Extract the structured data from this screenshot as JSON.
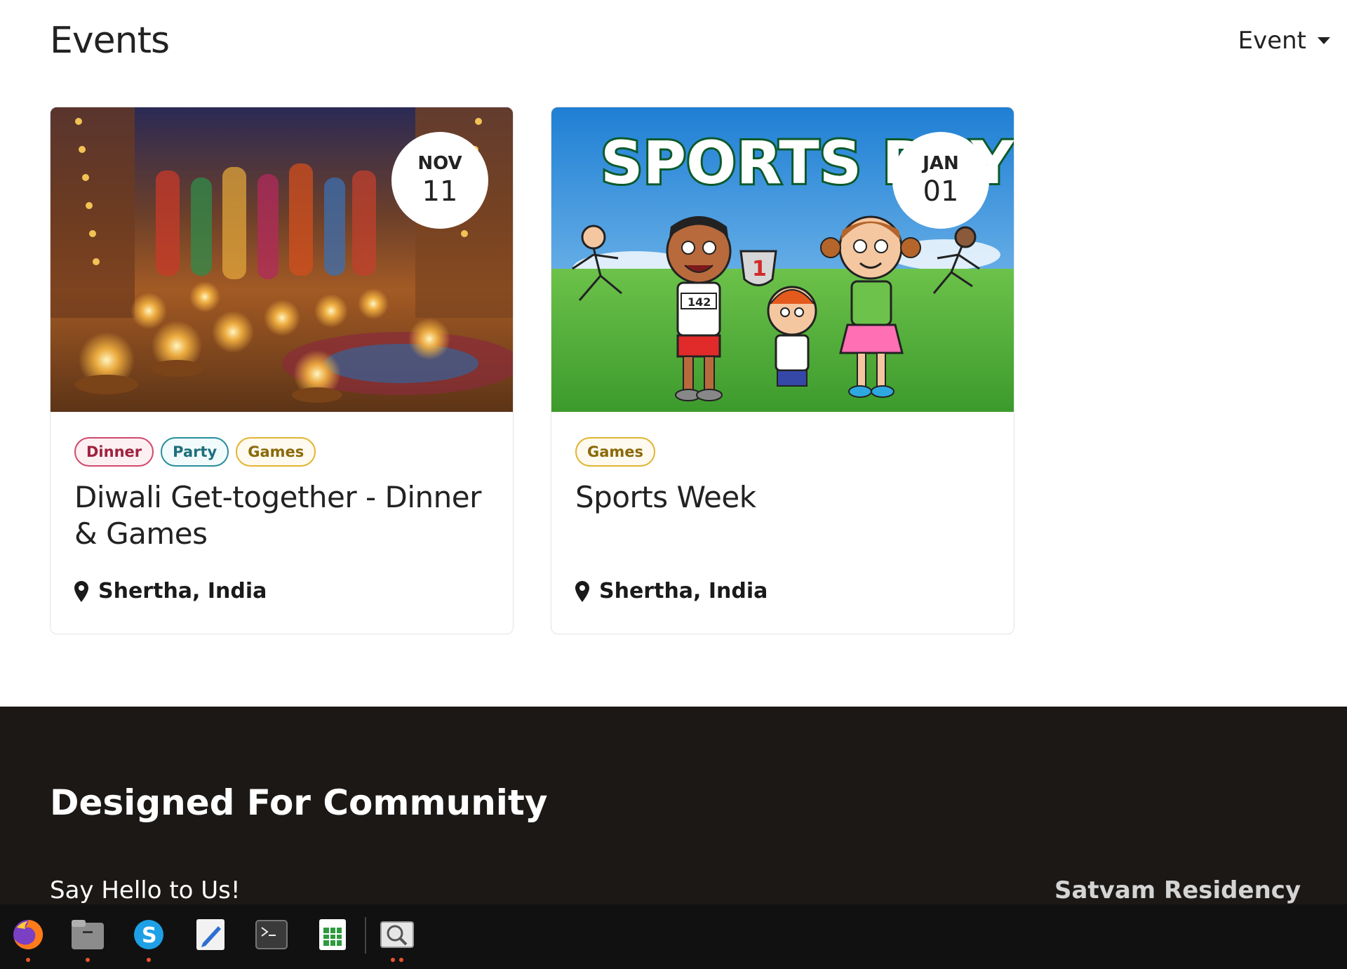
{
  "header": {
    "title": "Events",
    "dropdown_label": "Event"
  },
  "events": [
    {
      "date": {
        "month": "NOV",
        "day": "11"
      },
      "tags": [
        "Dinner",
        "Party",
        "Games"
      ],
      "title": "Diwali Get-together - Dinner & Games",
      "location": "Shertha, India",
      "image": "diwali-lamps-image"
    },
    {
      "date": {
        "month": "JAN",
        "day": "01"
      },
      "tags": [
        "Games"
      ],
      "title": "Sports Week",
      "location": "Shertha, India",
      "image": "sports-day-image",
      "image_text": "SPORTS DAY"
    }
  ],
  "footer": {
    "heading": "Designed For Community",
    "sub": "Say Hello to Us!",
    "brand": "Satvam Residency"
  },
  "taskbar": {
    "apps": [
      "firefox-icon",
      "files-icon",
      "skype-icon",
      "text-editor-icon",
      "terminal-icon",
      "spreadsheet-icon",
      "image-viewer-icon"
    ]
  },
  "colors": {
    "footer_bg": "#1b1816",
    "taskbar_bg": "#111111",
    "tag_dinner": "#d1496b",
    "tag_party": "#2a8d9c",
    "tag_games": "#e1b531"
  }
}
